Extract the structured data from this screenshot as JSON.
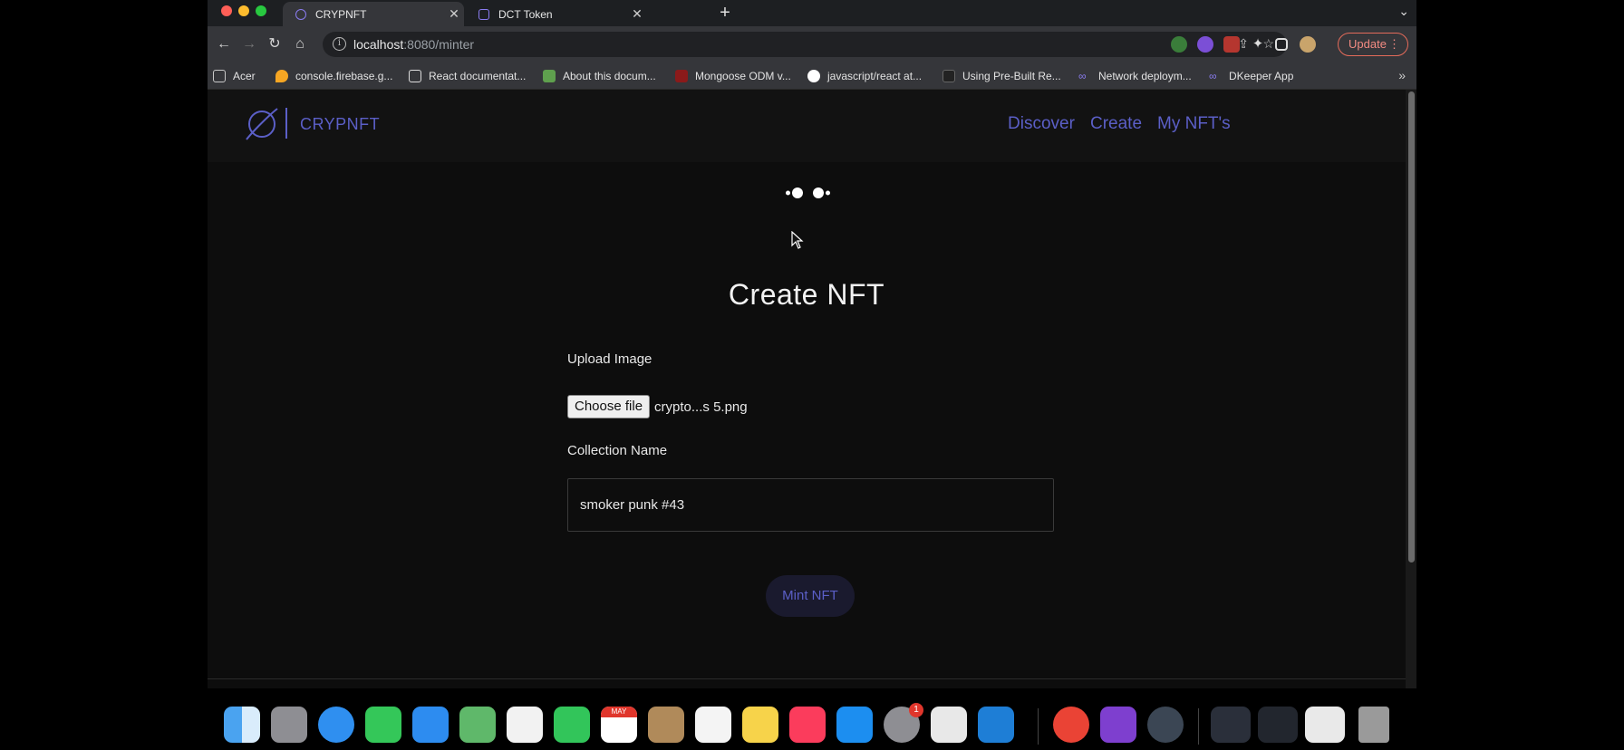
{
  "browser": {
    "tabs": [
      {
        "title": "CRYPNFT",
        "active": true
      },
      {
        "title": "DCT Token",
        "active": false
      }
    ],
    "new_tab_label": "+",
    "tab_menu_icon": "chevron-down-icon",
    "url_host": "localhost",
    "url_rest": ":8080/minter",
    "update_label": "Update",
    "bookmarks": [
      {
        "label": "Acer",
        "icon": "folder-icon",
        "color": "#c9c9c9"
      },
      {
        "label": "console.firebase.g...",
        "icon": "firebase-icon",
        "color": "#f6a623"
      },
      {
        "label": "React documentat...",
        "icon": "react-icon",
        "color": "#dddddd"
      },
      {
        "label": "About this docum...",
        "icon": "node-icon",
        "color": "#5fa04e"
      },
      {
        "label": "Mongoose ODM v...",
        "icon": "mongoose-icon",
        "color": "#8b1a1a"
      },
      {
        "label": "javascript/react at...",
        "icon": "github-icon",
        "color": "#ffffff"
      },
      {
        "label": "Using Pre-Built Re...",
        "icon": "page-icon",
        "color": "#222222"
      },
      {
        "label": "Network deploym...",
        "icon": "infinity-icon",
        "color": "#8a7cf0"
      },
      {
        "label": "DKeeper App",
        "icon": "infinity-icon",
        "color": "#8a7cf0"
      }
    ],
    "bookmarks_more": "»"
  },
  "site": {
    "logo_text": "CRYPNFT",
    "nav": [
      "Discover",
      "Create",
      "My NFT's"
    ]
  },
  "form": {
    "title": "Create NFT",
    "upload_label": "Upload Image",
    "choose_file_label": "Choose file",
    "file_name": "crypto...s 5.png",
    "collection_label": "Collection Name",
    "collection_value": "smoker punk #43",
    "mint_label": "Mint NFT"
  },
  "dock": {
    "apps": [
      "finder-icon",
      "launchpad-icon",
      "safari-icon",
      "messages-icon",
      "mail-icon",
      "maps-icon",
      "photos-icon",
      "facetime-icon",
      "calendar-icon",
      "contacts-icon",
      "reminders-icon",
      "notes-icon",
      "music-icon",
      "appstore-icon",
      "system-preferences-icon",
      "preview-icon",
      "vscode-icon",
      "chrome-icon",
      "github-desktop-icon",
      "quicktime-icon",
      "window-thumbnail-icon",
      "window-thumbnail-icon",
      "window-thumbnail-icon",
      "trash-icon"
    ],
    "calendar_month": "MAY",
    "settings_badge": "1"
  },
  "colors": {
    "accent": "#5b5fc7",
    "page_bg": "#0d0d0d",
    "header_bg": "#121212"
  }
}
